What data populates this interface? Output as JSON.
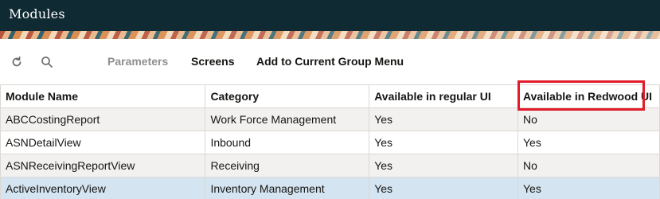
{
  "header": {
    "title": "Modules"
  },
  "toolbar": {
    "refresh_icon": "refresh-icon",
    "search_icon": "search-icon",
    "parameters_label": "Parameters",
    "screens_label": "Screens",
    "add_group_menu_label": "Add to Current Group Menu"
  },
  "table": {
    "columns": [
      "Module Name",
      "Category",
      "Available in regular UI",
      "Available in Redwood UI"
    ],
    "rows": [
      [
        "ABCCostingReport",
        "Work Force Management",
        "Yes",
        "No"
      ],
      [
        "ASNDetailView",
        "Inbound",
        "Yes",
        "Yes"
      ],
      [
        "ASNReceivingReportView",
        "Receiving",
        "Yes",
        "No"
      ],
      [
        "ActiveInventoryView",
        "Inventory Management",
        "Yes",
        "Yes"
      ]
    ]
  },
  "colors": {
    "header_bg": "#0f2a33",
    "highlight": "#e21a2a",
    "selected_row": "#d4e4f0"
  }
}
